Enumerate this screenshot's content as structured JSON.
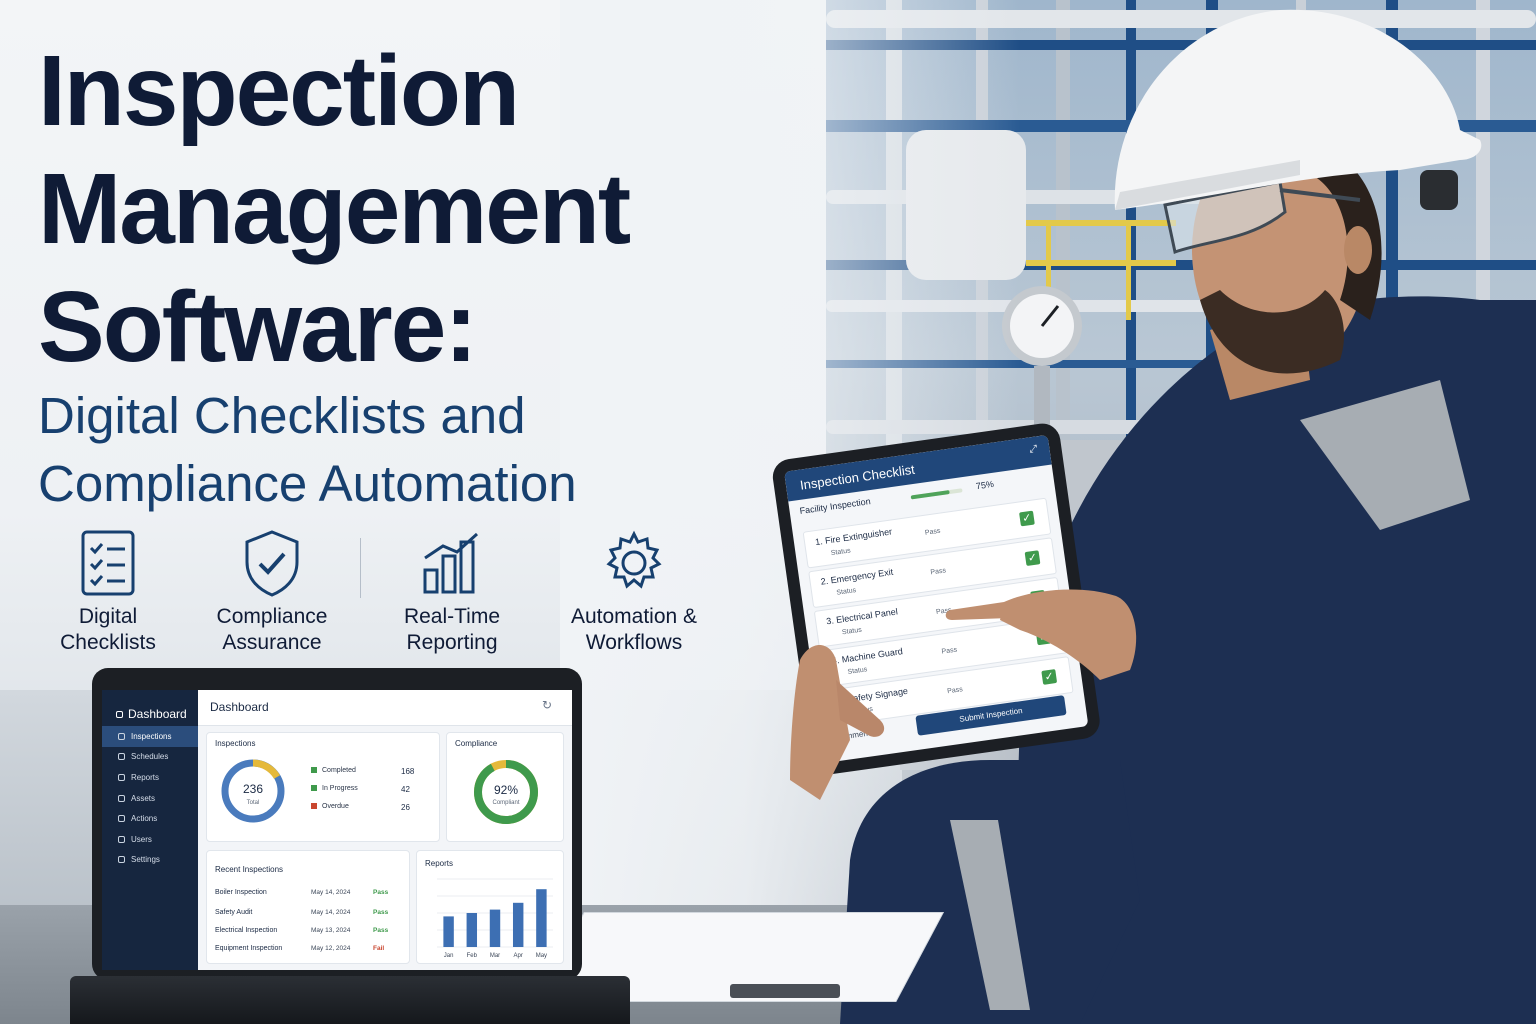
{
  "headline": {
    "line1": "Inspection",
    "line2": "Management",
    "line3": "Software:",
    "subtitle_line1": "Digital Checklists and",
    "subtitle_line2": "Compliance Automation"
  },
  "features": [
    {
      "icon": "checklist-icon",
      "line1": "Digital",
      "line2": "Checklists"
    },
    {
      "icon": "shield-check-icon",
      "line1": "Compliance",
      "line2": "Assurance"
    },
    {
      "icon": "bar-chart-icon",
      "line1": "Real-Time",
      "line2": "Reporting"
    },
    {
      "icon": "gear-icon",
      "line1": "Automation &",
      "line2": "Workflows"
    }
  ],
  "laptop": {
    "sidebar_brand": "Dashboard",
    "sidebar_items": [
      "Inspections",
      "Schedules",
      "Reports",
      "Assets",
      "Actions",
      "Users",
      "Settings"
    ],
    "page_title": "Dashboard",
    "inspections_card": {
      "title": "Inspections",
      "total_value": "236",
      "total_label": "Total",
      "legend": [
        {
          "label": "Completed",
          "value": "168",
          "color": "#3f9a4c"
        },
        {
          "label": "In Progress",
          "value": "42",
          "color": "#3f9a4c"
        },
        {
          "label": "Overdue",
          "value": "26",
          "color": "#c9462f"
        }
      ]
    },
    "compliance_card": {
      "title": "Compliance",
      "value": "92%",
      "label": "Compliant",
      "fraction": 0.92
    },
    "recent": {
      "title": "Recent Inspections",
      "rows": [
        {
          "name": "Boiler Inspection",
          "date": "May 14, 2024",
          "result": "Pass"
        },
        {
          "name": "Safety Audit",
          "date": "May 14, 2024",
          "result": "Pass"
        },
        {
          "name": "Electrical Inspection",
          "date": "May 13, 2024",
          "result": "Pass"
        },
        {
          "name": "Equipment Inspection",
          "date": "May 12, 2024",
          "result": "Fail"
        }
      ]
    },
    "reports": {
      "title": "Reports",
      "categories": [
        "Jan",
        "Feb",
        "Mar",
        "Apr",
        "May"
      ],
      "values": [
        45,
        50,
        55,
        65,
        85
      ],
      "ylim": [
        0,
        100
      ]
    }
  },
  "tablet": {
    "header": "Inspection Checklist",
    "subtitle": "Facility Inspection",
    "progress_pct": "75%",
    "progress_fraction": 0.75,
    "items": [
      {
        "name": "1.  Fire Extinguisher",
        "status": "Status",
        "result": "Pass"
      },
      {
        "name": "2.  Emergency Exit",
        "status": "Status",
        "result": "Pass"
      },
      {
        "name": "3.  Electrical Panel",
        "status": "Status",
        "result": "Pass"
      },
      {
        "name": "4.  Machine Guard",
        "status": "Status",
        "result": "Pass"
      },
      {
        "name": "5.  Safety Signage",
        "status": "Status",
        "result": "Pass"
      }
    ],
    "comments_label": "Comments",
    "submit_label": "Submit Inspection"
  },
  "colors": {
    "navy": "#0f1b36",
    "accent_blue": "#17406f",
    "pass_green": "#3f9a4c",
    "fail_red": "#c9462f"
  }
}
